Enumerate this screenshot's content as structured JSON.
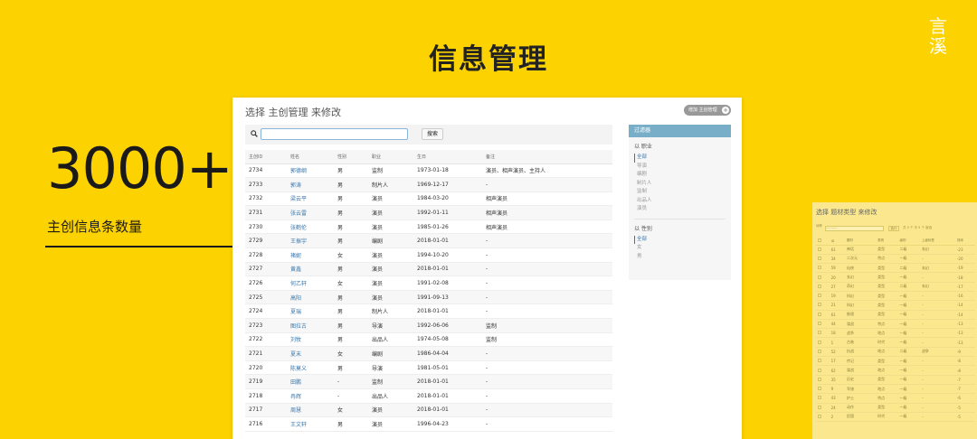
{
  "slide": {
    "title": "信息管理",
    "big_number": "3000+",
    "caption": "主创信息条数量",
    "logo_top": "言",
    "logo_bottom": "溪"
  },
  "admin": {
    "heading": "选择 主创管理 来修改",
    "add_button": "增加 主创管理",
    "search_button": "搜索",
    "columns": [
      "主创ID",
      "姓名",
      "性别",
      "职业",
      "生日",
      "备注"
    ],
    "rows": [
      [
        "2734",
        "郭德纲",
        "男",
        "监制",
        "1973-01-18",
        "演员、相声演员、主持人"
      ],
      [
        "2733",
        "郭涛",
        "男",
        "制片人",
        "1969-12-17",
        "-"
      ],
      [
        "2732",
        "梁云平",
        "男",
        "演员",
        "1984-03-20",
        "相声演员"
      ],
      [
        "2731",
        "张云雷",
        "男",
        "演员",
        "1992-01-11",
        "相声演员"
      ],
      [
        "2730",
        "张鹤伦",
        "男",
        "演员",
        "1985-01-26",
        "相声演员"
      ],
      [
        "2729",
        "王振宇",
        "男",
        "编剧",
        "2018-01-01",
        "-"
      ],
      [
        "2728",
        "褚妮",
        "女",
        "演员",
        "1994-10-20",
        "-"
      ],
      [
        "2727",
        "黄鑫",
        "男",
        "演员",
        "2018-01-01",
        "-"
      ],
      [
        "2726",
        "何乙轩",
        "女",
        "演员",
        "1991-02-08",
        "-"
      ],
      [
        "2725",
        "高阳",
        "男",
        "演员",
        "1991-09-13",
        "-"
      ],
      [
        "2724",
        "夏瑞",
        "男",
        "制片人",
        "2018-01-01",
        "-"
      ],
      [
        "2723",
        "图拉古",
        "男",
        "导演",
        "1992-06-06",
        "监制"
      ],
      [
        "2722",
        "刘牧",
        "男",
        "出品人",
        "1974-05-08",
        "监制"
      ],
      [
        "2721",
        "夏末",
        "女",
        "编剧",
        "1986-04-04",
        "-"
      ],
      [
        "2720",
        "陈莫义",
        "男",
        "导演",
        "1981-05-01",
        "-"
      ],
      [
        "2719",
        "田鹏",
        "-",
        "监制",
        "2018-01-01",
        "-"
      ],
      [
        "2718",
        "冉辉",
        "-",
        "出品人",
        "2018-01-01",
        "-"
      ],
      [
        "2717",
        "周慧",
        "女",
        "演员",
        "2018-01-01",
        "-"
      ],
      [
        "2716",
        "王文轩",
        "男",
        "演员",
        "1996-04-23",
        "-"
      ]
    ],
    "filter": {
      "title": "过滤器",
      "group1_title": "以 职业",
      "group1_options": [
        "全部",
        "导演",
        "编剧",
        "制片人",
        "监制",
        "出品人",
        "演员"
      ],
      "group2_title": "以 性别",
      "group2_options": [
        "全部",
        "女",
        "男"
      ]
    }
  },
  "secondary": {
    "heading": "选择 题材类型 来修改",
    "search_placeholder": "···········",
    "search_button": "执行",
    "result_text": "共 5 个 中 5 个 被选",
    "columns": [
      "ID",
      "题材",
      "类别",
      "级别",
      "上级标签",
      "排序"
    ],
    "rows": [
      [
        "61",
        "神话",
        "类型",
        "二级",
        "玄幻",
        "-23"
      ],
      [
        "34",
        "二次元",
        "特点",
        "一级",
        "-",
        "-20"
      ],
      [
        "59",
        "仙侠",
        "类型",
        "二级",
        "玄幻",
        "-19"
      ],
      [
        "20",
        "玄幻",
        "类型",
        "一级",
        "-",
        "-18"
      ],
      [
        "27",
        "奇幻",
        "类型",
        "二级",
        "玄幻",
        "-17"
      ],
      [
        "19",
        "科幻",
        "类型",
        "一级",
        "-",
        "-16"
      ],
      [
        "21",
        "科幻",
        "类型",
        "一级",
        "-",
        "-14"
      ],
      [
        "61",
        "推理",
        "类型",
        "一级",
        "-",
        "-14"
      ],
      [
        "44",
        "谍战",
        "特点",
        "一级",
        "-",
        "-13"
      ],
      [
        "18",
        "战争",
        "地点",
        "一级",
        "-",
        "-13"
      ],
      [
        "1",
        "古装",
        "时代",
        "一级",
        "-",
        "-13"
      ],
      [
        "52",
        "抗战",
        "地点",
        "二级",
        "战争",
        "-9"
      ],
      [
        "17",
        "传记",
        "类型",
        "一级",
        "-",
        "-8"
      ],
      [
        "62",
        "谍战",
        "地点",
        "一级",
        "-",
        "-8"
      ],
      [
        "35",
        "历史",
        "类型",
        "一级",
        "-",
        "-7"
      ],
      [
        "9",
        "军旅",
        "地点",
        "一级",
        "-",
        "-7"
      ],
      [
        "43",
        "护士",
        "特点",
        "一级",
        "-",
        "-6"
      ],
      [
        "24",
        "动作",
        "类型",
        "一级",
        "-",
        "-5"
      ],
      [
        "2",
        "民国",
        "时代",
        "一级",
        "-",
        "-5"
      ]
    ]
  }
}
